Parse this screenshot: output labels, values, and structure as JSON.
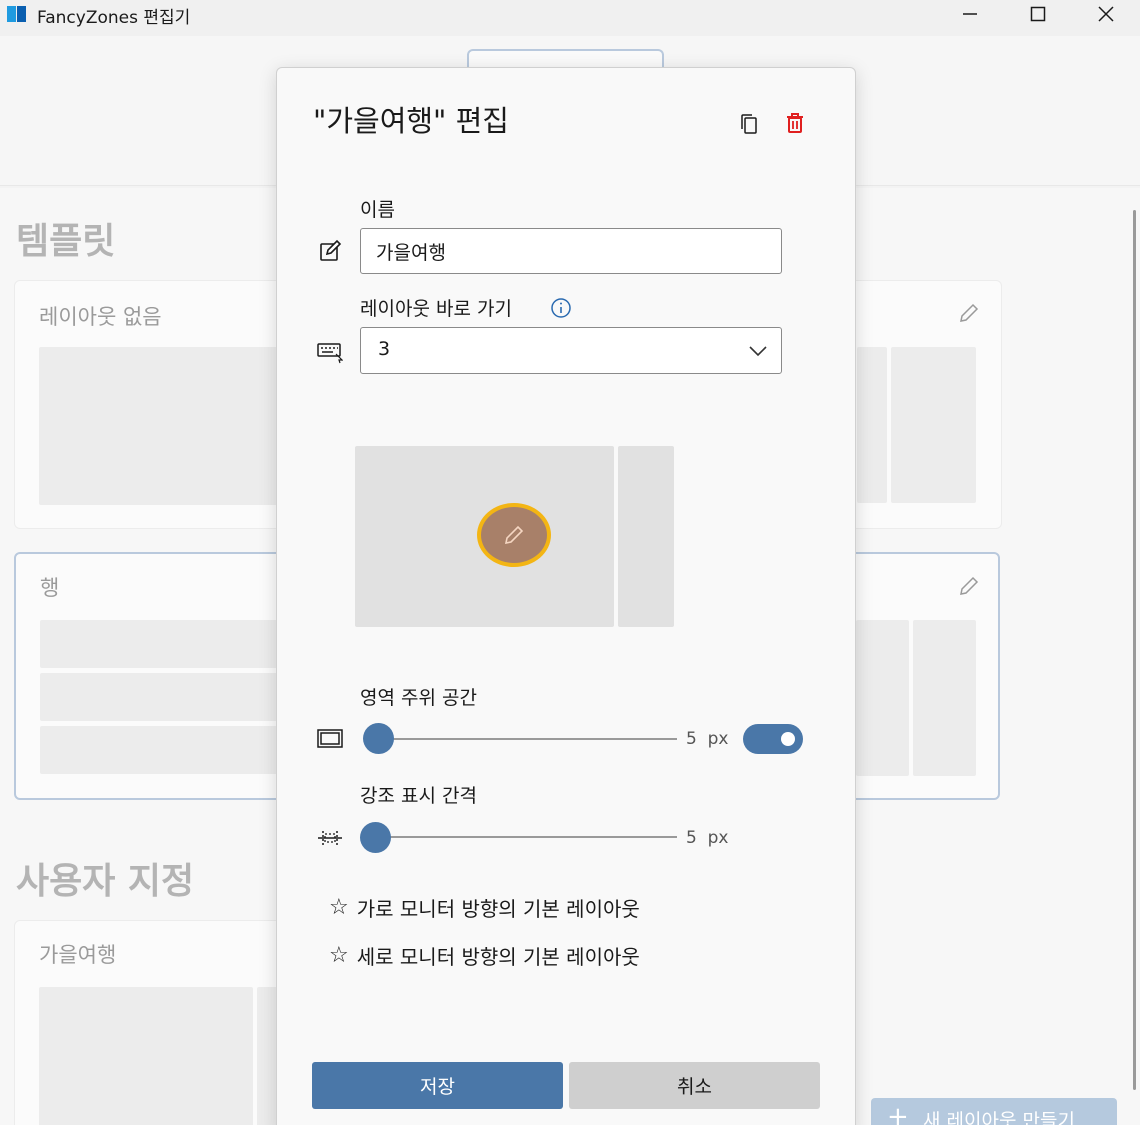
{
  "window": {
    "title": "FancyZones 편집기"
  },
  "background": {
    "templates_title": "템플릿",
    "custom_title": "사용자 지정",
    "cards": {
      "no_layout": "레이아웃 없음",
      "rows": "행",
      "custom": "가을여행"
    },
    "new_layout_button": "새 레이아웃 만들기"
  },
  "dialog": {
    "title": "\"가을여행\" 편집",
    "name_label": "이름",
    "name_value": "가을여행",
    "shortcut_label": "레이아웃 바로 가기",
    "shortcut_value": "3",
    "spacing_label": "영역 주위 공간",
    "spacing_value": "5",
    "spacing_unit": "px",
    "spacing_enabled": true,
    "highlight_label": "강조 표시 간격",
    "highlight_value": "5",
    "highlight_unit": "px",
    "favorites": {
      "horizontal": "가로 모니터 방향의 기본 레이아웃",
      "vertical": "세로 모니터 방향의 기본 레이아웃"
    },
    "save_label": "저장",
    "cancel_label": "취소"
  },
  "colors": {
    "accent": "#4a77a8",
    "delete": "#e02020",
    "focus_ring": "#f3b514"
  },
  "icons": [
    "app-icon",
    "minimize-icon",
    "maximize-icon",
    "close-icon",
    "copy-icon",
    "delete-icon",
    "rename-icon",
    "keyboard-icon",
    "info-icon",
    "chevron-down-icon",
    "pencil-icon",
    "spacing-icon",
    "distance-icon",
    "star-icon"
  ]
}
